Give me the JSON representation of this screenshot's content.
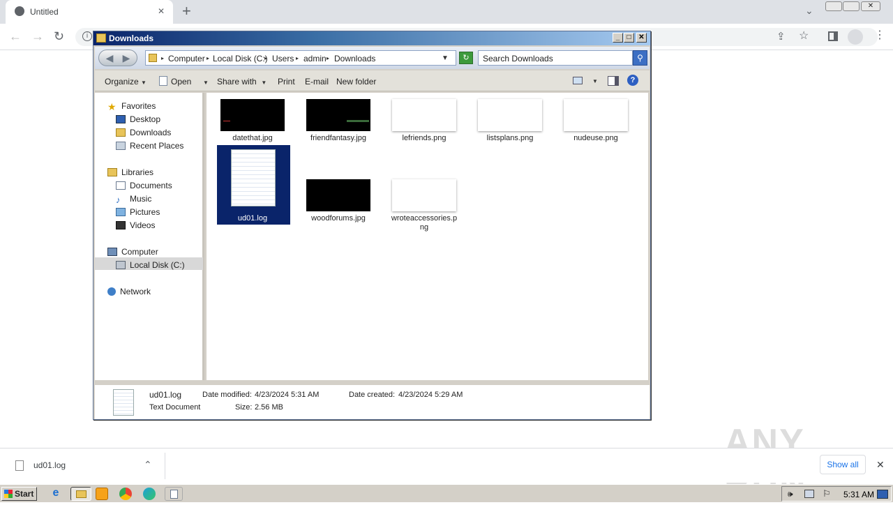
{
  "browser": {
    "tab_title": "Untitled",
    "new_tab_label": "+",
    "close_tab": "✕"
  },
  "explorer": {
    "window_title": "Downloads",
    "breadcrumb": [
      "Computer",
      "Local Disk (C:)",
      "Users",
      "admin",
      "Downloads"
    ],
    "search_placeholder": "Search Downloads",
    "commands": {
      "organize": "Organize",
      "open": "Open",
      "share_with": "Share with",
      "print": "Print",
      "email": "E-mail",
      "new_folder": "New folder"
    },
    "nav": {
      "favorites": "Favorites",
      "desktop": "Desktop",
      "downloads": "Downloads",
      "recent_places": "Recent Places",
      "libraries": "Libraries",
      "documents": "Documents",
      "music": "Music",
      "pictures": "Pictures",
      "videos": "Videos",
      "computer": "Computer",
      "local_disk": "Local Disk (C:)",
      "network": "Network"
    },
    "files": [
      {
        "name": "datethat.jpg",
        "thumb": "dark"
      },
      {
        "name": "friendfantasy.jpg",
        "thumb": "dark"
      },
      {
        "name": "lefriends.png",
        "thumb": "light"
      },
      {
        "name": "listsplans.png",
        "thumb": "light"
      },
      {
        "name": "nudeuse.png",
        "thumb": "light"
      },
      {
        "name": "ud01.log",
        "thumb": "doc",
        "selected": true
      },
      {
        "name": "woodforums.jpg",
        "thumb": "dark"
      },
      {
        "name": "wroteaccessories.png",
        "thumb": "light"
      }
    ],
    "details": {
      "file_name": "ud01.log",
      "file_type": "Text Document",
      "date_modified_label": "Date modified:",
      "date_modified": "4/23/2024 5:31 AM",
      "size_label": "Size:",
      "size": "2.56 MB",
      "date_created_label": "Date created:",
      "date_created": "4/23/2024 5:29 AM"
    }
  },
  "download_shelf": {
    "file_name": "ud01.log",
    "show_all": "Show all"
  },
  "taskbar": {
    "start": "Start",
    "clock": "5:31 AM"
  },
  "watermark": "ANY RUN"
}
